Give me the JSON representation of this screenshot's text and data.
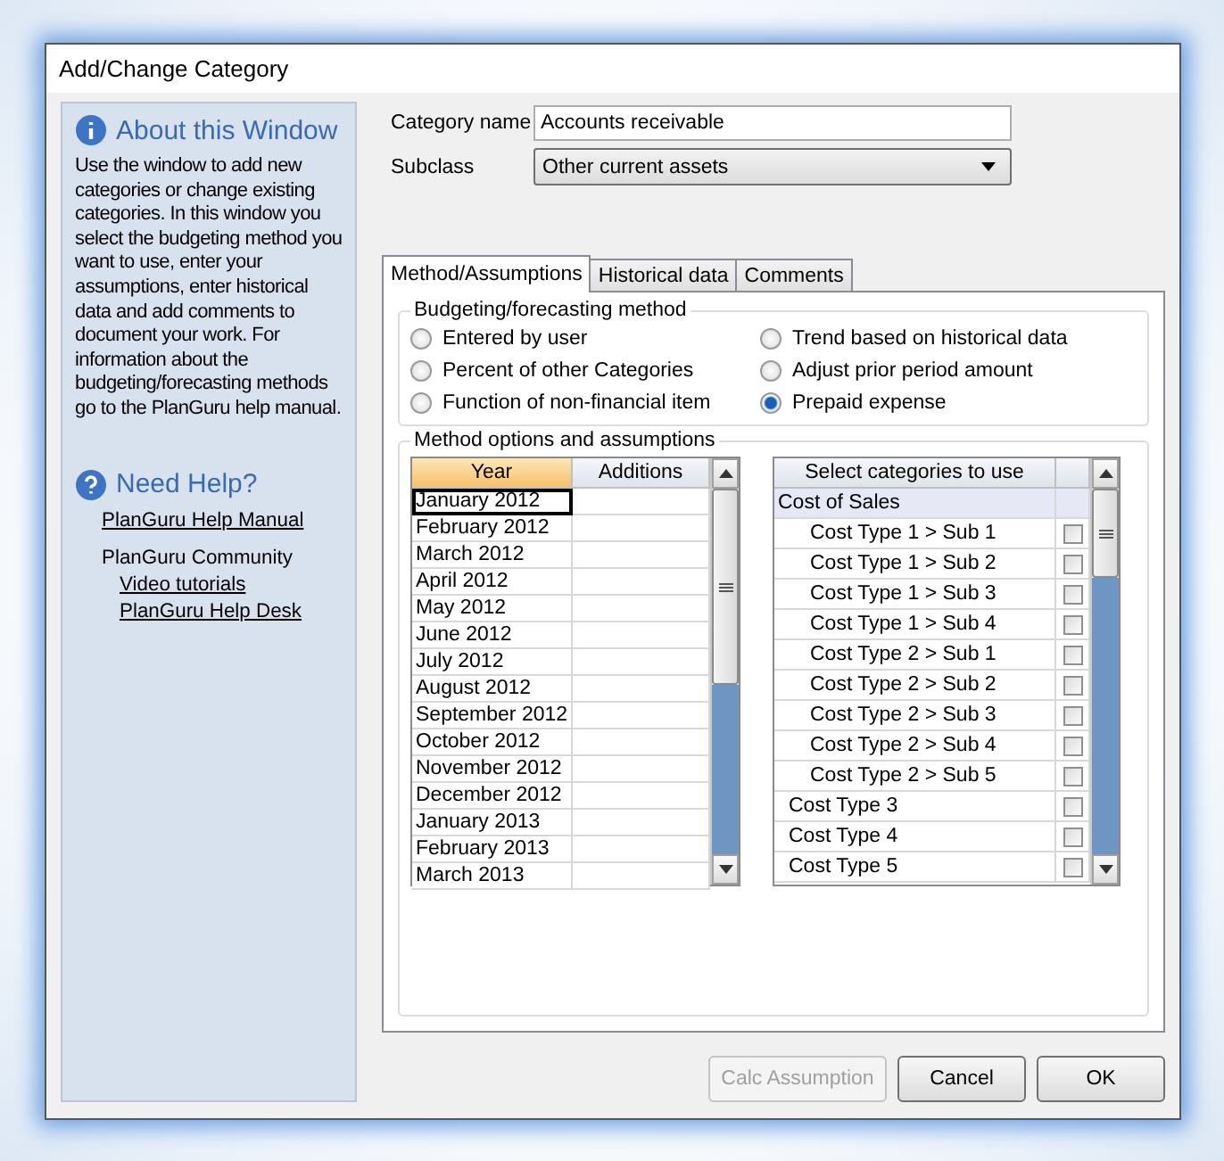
{
  "window": {
    "title": "Add/Change Category"
  },
  "about": {
    "title": "About this Window",
    "text": "Use the window to add new categories or change existing categories.  In this window you select the budgeting method you want to use, enter your assumptions, enter historical data and add comments to document your work.  For information about the budgeting/forecasting methods go to the PlanGuru help manual."
  },
  "help": {
    "title": "Need Help?",
    "manual_link": "PlanGuru Help Manual",
    "community": "PlanGuru Community",
    "community_links": [
      "Video tutorials",
      "PlanGuru Help Desk"
    ]
  },
  "form": {
    "category_label": "Category name",
    "category_value": "Accounts receivable",
    "subclass_label": "Subclass",
    "subclass_value": "Other current assets"
  },
  "tabs": [
    {
      "label": "Method/Assumptions",
      "selected": true
    },
    {
      "label": "Historical data",
      "selected": false
    },
    {
      "label": "Comments",
      "selected": false
    }
  ],
  "method_group": {
    "title": "Budgeting/forecasting method",
    "options": [
      {
        "label": "Entered by user",
        "selected": false
      },
      {
        "label": "Percent of other Categories",
        "selected": false
      },
      {
        "label": "Function of non-financial item",
        "selected": false
      },
      {
        "label": "Trend based on historical data",
        "selected": false
      },
      {
        "label": "Adjust prior period amount",
        "selected": false
      },
      {
        "label": "Prepaid expense",
        "selected": true
      }
    ]
  },
  "options_group": {
    "title": "Method options and assumptions"
  },
  "year_table": {
    "columns": [
      "Year",
      "Additions"
    ],
    "rows": [
      {
        "year": "January  2012",
        "selected": true
      },
      {
        "year": "February  2012",
        "selected": false
      },
      {
        "year": "March  2012",
        "selected": false
      },
      {
        "year": "April  2012",
        "selected": false
      },
      {
        "year": "May  2012",
        "selected": false
      },
      {
        "year": "June  2012",
        "selected": false
      },
      {
        "year": "July  2012",
        "selected": false
      },
      {
        "year": "August  2012",
        "selected": false
      },
      {
        "year": "September  2012",
        "selected": false
      },
      {
        "year": "October  2012",
        "selected": false
      },
      {
        "year": "November  2012",
        "selected": false
      },
      {
        "year": "December  2012",
        "selected": false
      },
      {
        "year": "January  2013",
        "selected": false
      },
      {
        "year": "February  2013",
        "selected": false
      },
      {
        "year": "March  2013",
        "selected": false
      }
    ]
  },
  "category_table": {
    "header": "Select categories to use",
    "rows": [
      {
        "label": "Cost of Sales",
        "kind": "group"
      },
      {
        "label": "Cost Type 1 > Sub 1",
        "kind": "sub",
        "checked": false
      },
      {
        "label": "Cost Type 1 > Sub 2",
        "kind": "sub",
        "checked": false
      },
      {
        "label": "Cost Type 1 > Sub 3",
        "kind": "sub",
        "checked": false
      },
      {
        "label": "Cost Type 1 > Sub 4",
        "kind": "sub",
        "checked": false
      },
      {
        "label": "Cost Type 2 > Sub 1",
        "kind": "sub",
        "checked": false
      },
      {
        "label": "Cost Type 2 > Sub 2",
        "kind": "sub",
        "checked": false
      },
      {
        "label": "Cost Type 2 > Sub 3",
        "kind": "sub",
        "checked": false
      },
      {
        "label": "Cost Type 2 > Sub 4",
        "kind": "sub",
        "checked": false
      },
      {
        "label": "Cost Type 2 > Sub 5",
        "kind": "sub",
        "checked": false
      },
      {
        "label": "Cost Type 3",
        "kind": "type",
        "checked": false
      },
      {
        "label": "Cost Type 4",
        "kind": "type",
        "checked": false
      },
      {
        "label": "Cost Type 5",
        "kind": "type",
        "checked": false
      }
    ]
  },
  "buttons": [
    {
      "label": "Calc Assumption",
      "disabled": true
    },
    {
      "label": "Cancel",
      "disabled": false
    },
    {
      "label": "OK",
      "disabled": false
    }
  ]
}
